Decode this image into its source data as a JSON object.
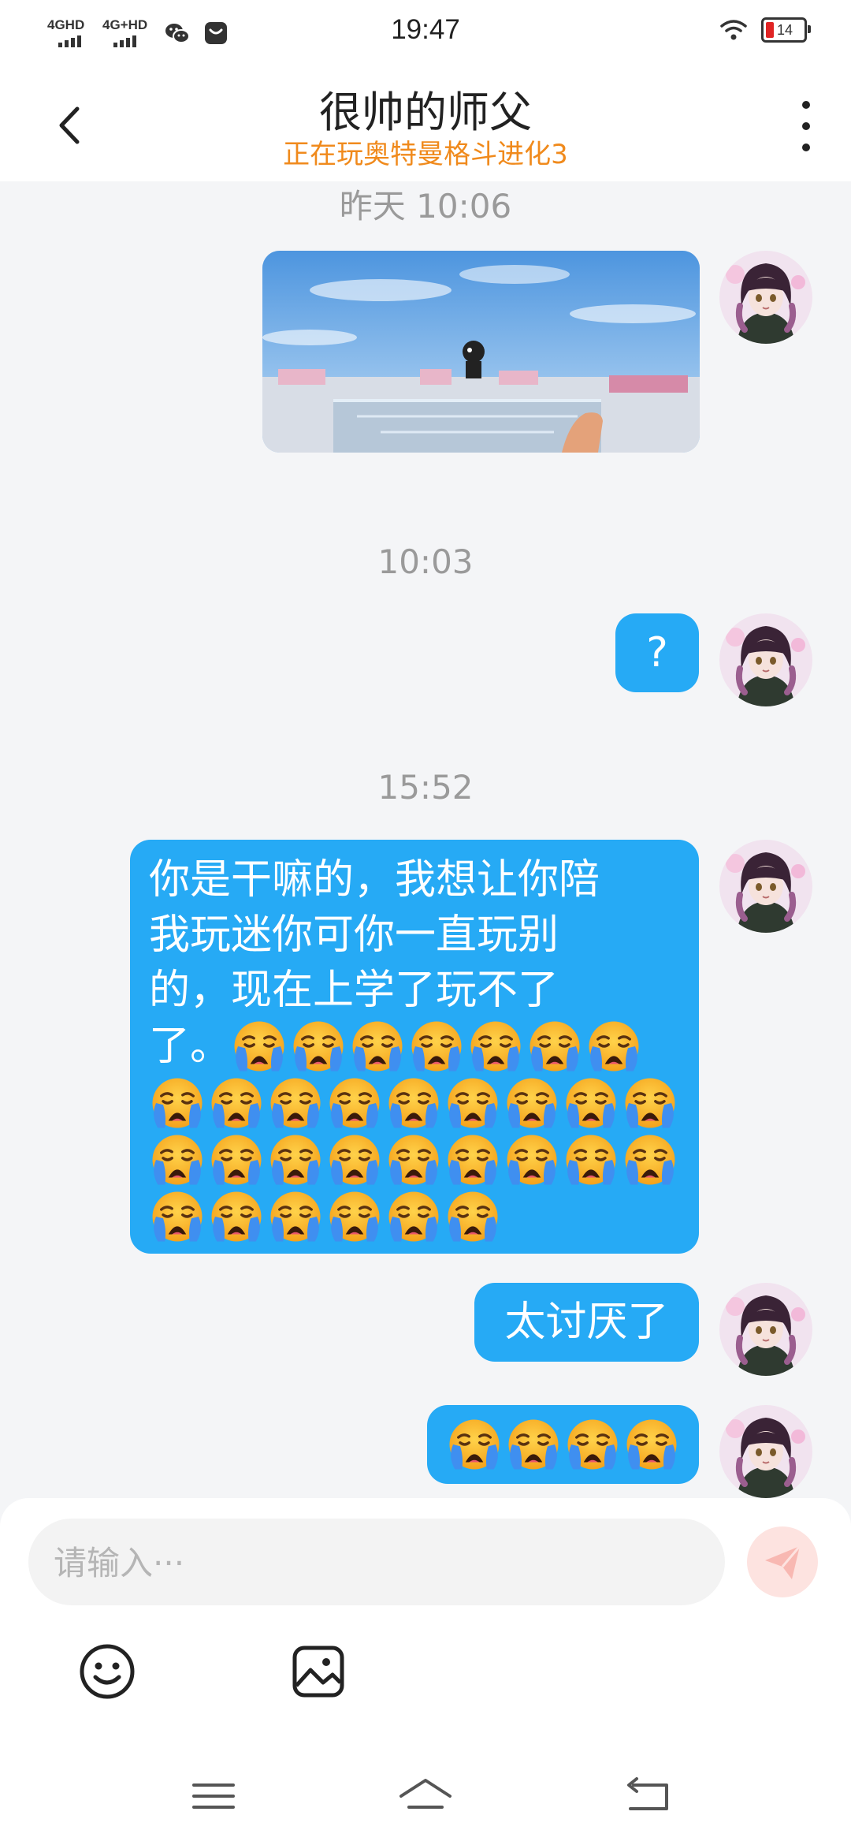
{
  "status_bar": {
    "time": "19:47",
    "sim1_label": "4GHD",
    "sim2_label": "4G+HD",
    "battery_level": "14",
    "icons": [
      "signal-icon",
      "wechat-icon",
      "app-notification-icon",
      "wifi-icon",
      "battery-icon"
    ]
  },
  "header": {
    "title": "很帅的师父",
    "subtitle": "正在玩奥特曼格斗进化3",
    "back_icon": "chevron-left-icon",
    "more_icon": "more-vertical-icon",
    "subtitle_color": "#f08a1c"
  },
  "chat": {
    "messages": [
      {
        "timestamp": "昨天 10:06",
        "type": "image",
        "content": "game screenshot"
      },
      {
        "timestamp": "10:03",
        "type": "text",
        "text": "?"
      },
      {
        "timestamp": "15:52",
        "type": "text",
        "text": "你是干嘛的，我想让你陪我玩迷你可你一直玩别的，现在上学了玩不了了。",
        "emoji_count": 31
      },
      {
        "type": "text",
        "text": "太讨厌了"
      },
      {
        "type": "emoji",
        "emoji_count": 4
      }
    ],
    "msg2_line1": "你是干嘛的，我想让你陪",
    "msg2_line2": "我玩迷你可你一直玩别",
    "msg2_line3": "的，现在上学了玩不了",
    "msg2_line4": "了。",
    "bubble_color": "#26aaf5",
    "emoji_name": "loudly-crying-face"
  },
  "input": {
    "placeholder": "请输入···",
    "value": "",
    "send_icon": "paper-plane-icon"
  },
  "toolbar": {
    "emoji_icon": "smiley-icon",
    "image_icon": "image-icon"
  },
  "nav_bar": {
    "icons": [
      "menu-icon",
      "home-icon",
      "back-icon"
    ]
  }
}
